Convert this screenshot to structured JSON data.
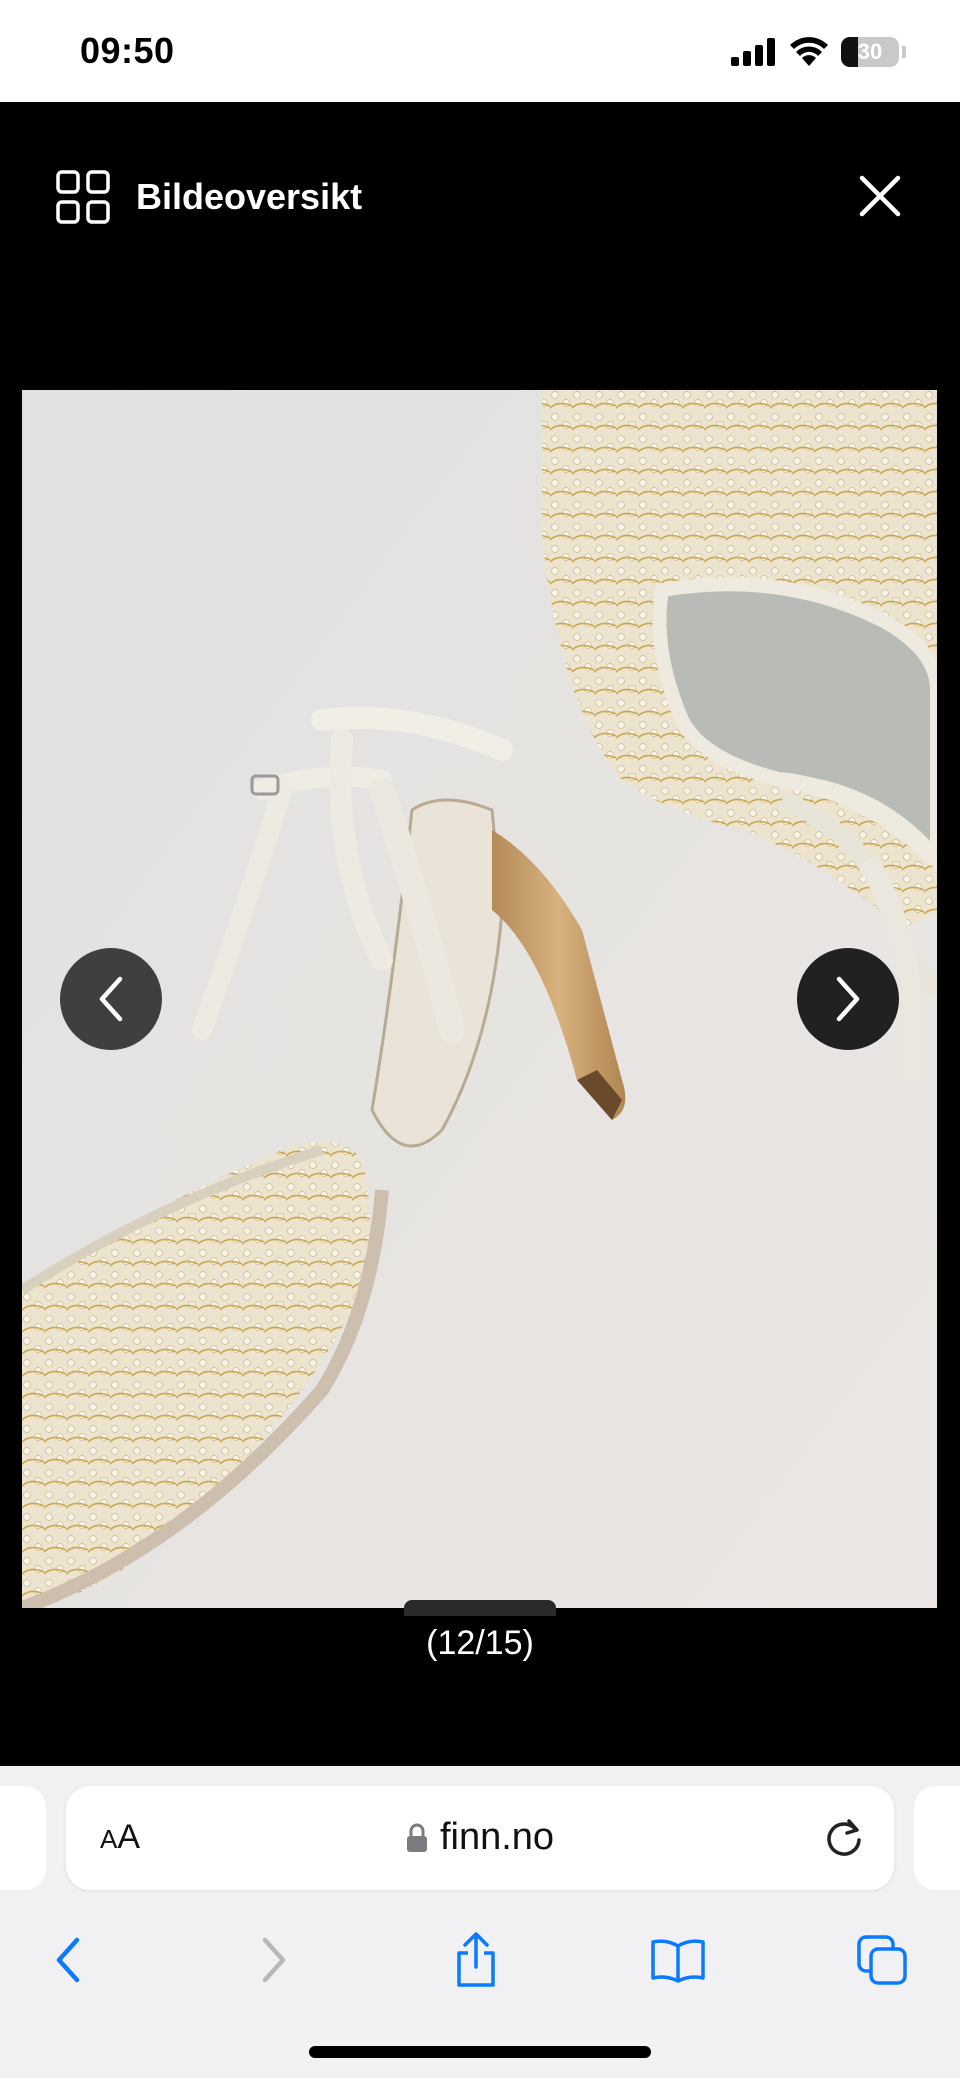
{
  "status_bar": {
    "time": "09:50",
    "battery_level": "30",
    "icons": [
      "cellular-signal-icon",
      "wifi-icon",
      "battery-icon"
    ]
  },
  "viewer": {
    "overview_label": "Bildeoversikt",
    "overview_icon": "grid-icon",
    "close_icon": "close-icon",
    "counter": "(12/15)",
    "prev_icon": "chevron-left-icon",
    "next_icon": "chevron-right-icon",
    "photo_subject": "beaded-heel-shoes"
  },
  "browser": {
    "text_size_small": "A",
    "text_size_large": "A",
    "url": "finn.no",
    "lock_icon": "lock-icon",
    "reload_icon": "reload-icon",
    "toolbar": [
      "back-icon",
      "forward-icon",
      "share-icon",
      "bookmarks-icon",
      "tabs-icon"
    ],
    "colors": {
      "accent": "#0a7aff",
      "disabled": "#b6b6bb"
    }
  }
}
